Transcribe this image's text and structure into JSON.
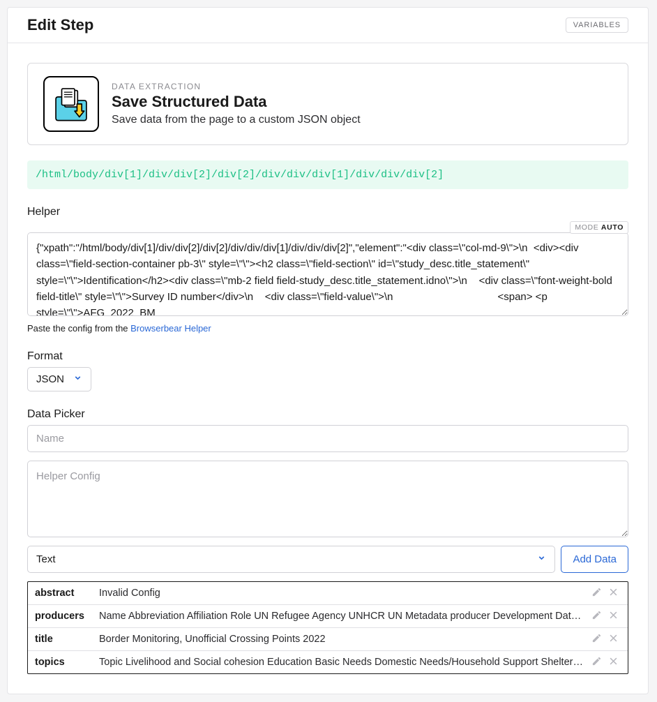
{
  "header": {
    "title": "Edit Step",
    "variables_button": "VARIABLES"
  },
  "action_card": {
    "eyebrow": "DATA EXTRACTION",
    "title": "Save Structured Data",
    "description": "Save data from the page to a custom JSON object"
  },
  "xpath": "/html/body/div[1]/div/div[2]/div[2]/div/div/div[1]/div/div/div[2]",
  "helper": {
    "label": "Helper",
    "mode_label": "MODE ",
    "mode_value": "AUTO",
    "value": "{\"xpath\":\"/html/body/div[1]/div/div[2]/div[2]/div/div/div[1]/div/div/div[2]\",\"element\":\"<div class=\\\"col-md-9\\\">\\n  <div><div class=\\\"field-section-container pb-3\\\" style=\\\"\\\"><h2 class=\\\"field-section\\\" id=\\\"study_desc.title_statement\\\" style=\\\"\\\">Identification</h2><div class=\\\"mb-2 field field-study_desc.title_statement.idno\\\">\\n    <div class=\\\"font-weight-bold field-title\\\" style=\\\"\\\">Survey ID number</div>\\n    <div class=\\\"field-value\\\">\\n                                    <span> <p style=\\\"\\\">AFG_2022_BM",
    "hint_prefix": "Paste the config from the ",
    "hint_link_text": "Browserbear Helper"
  },
  "format": {
    "label": "Format",
    "value": "JSON"
  },
  "data_picker": {
    "label": "Data Picker",
    "name_placeholder": "Name",
    "helper_config_placeholder": "Helper Config",
    "type_value": "Text",
    "add_button": "Add Data"
  },
  "rows": [
    {
      "key": "abstract",
      "value": "Invalid Config"
    },
    {
      "key": "producers",
      "value": "Name Abbreviation Affiliation Role UN Refugee Agency UNHCR UN Metadata producer Development Data Gro…"
    },
    {
      "key": "title",
      "value": "Border Monitoring, Unofficial Crossing Points 2022"
    },
    {
      "key": "topics",
      "value": "Topic Livelihood and Social cohesion Education Basic Needs Domestic Needs/Household Support Shelter/…"
    }
  ]
}
